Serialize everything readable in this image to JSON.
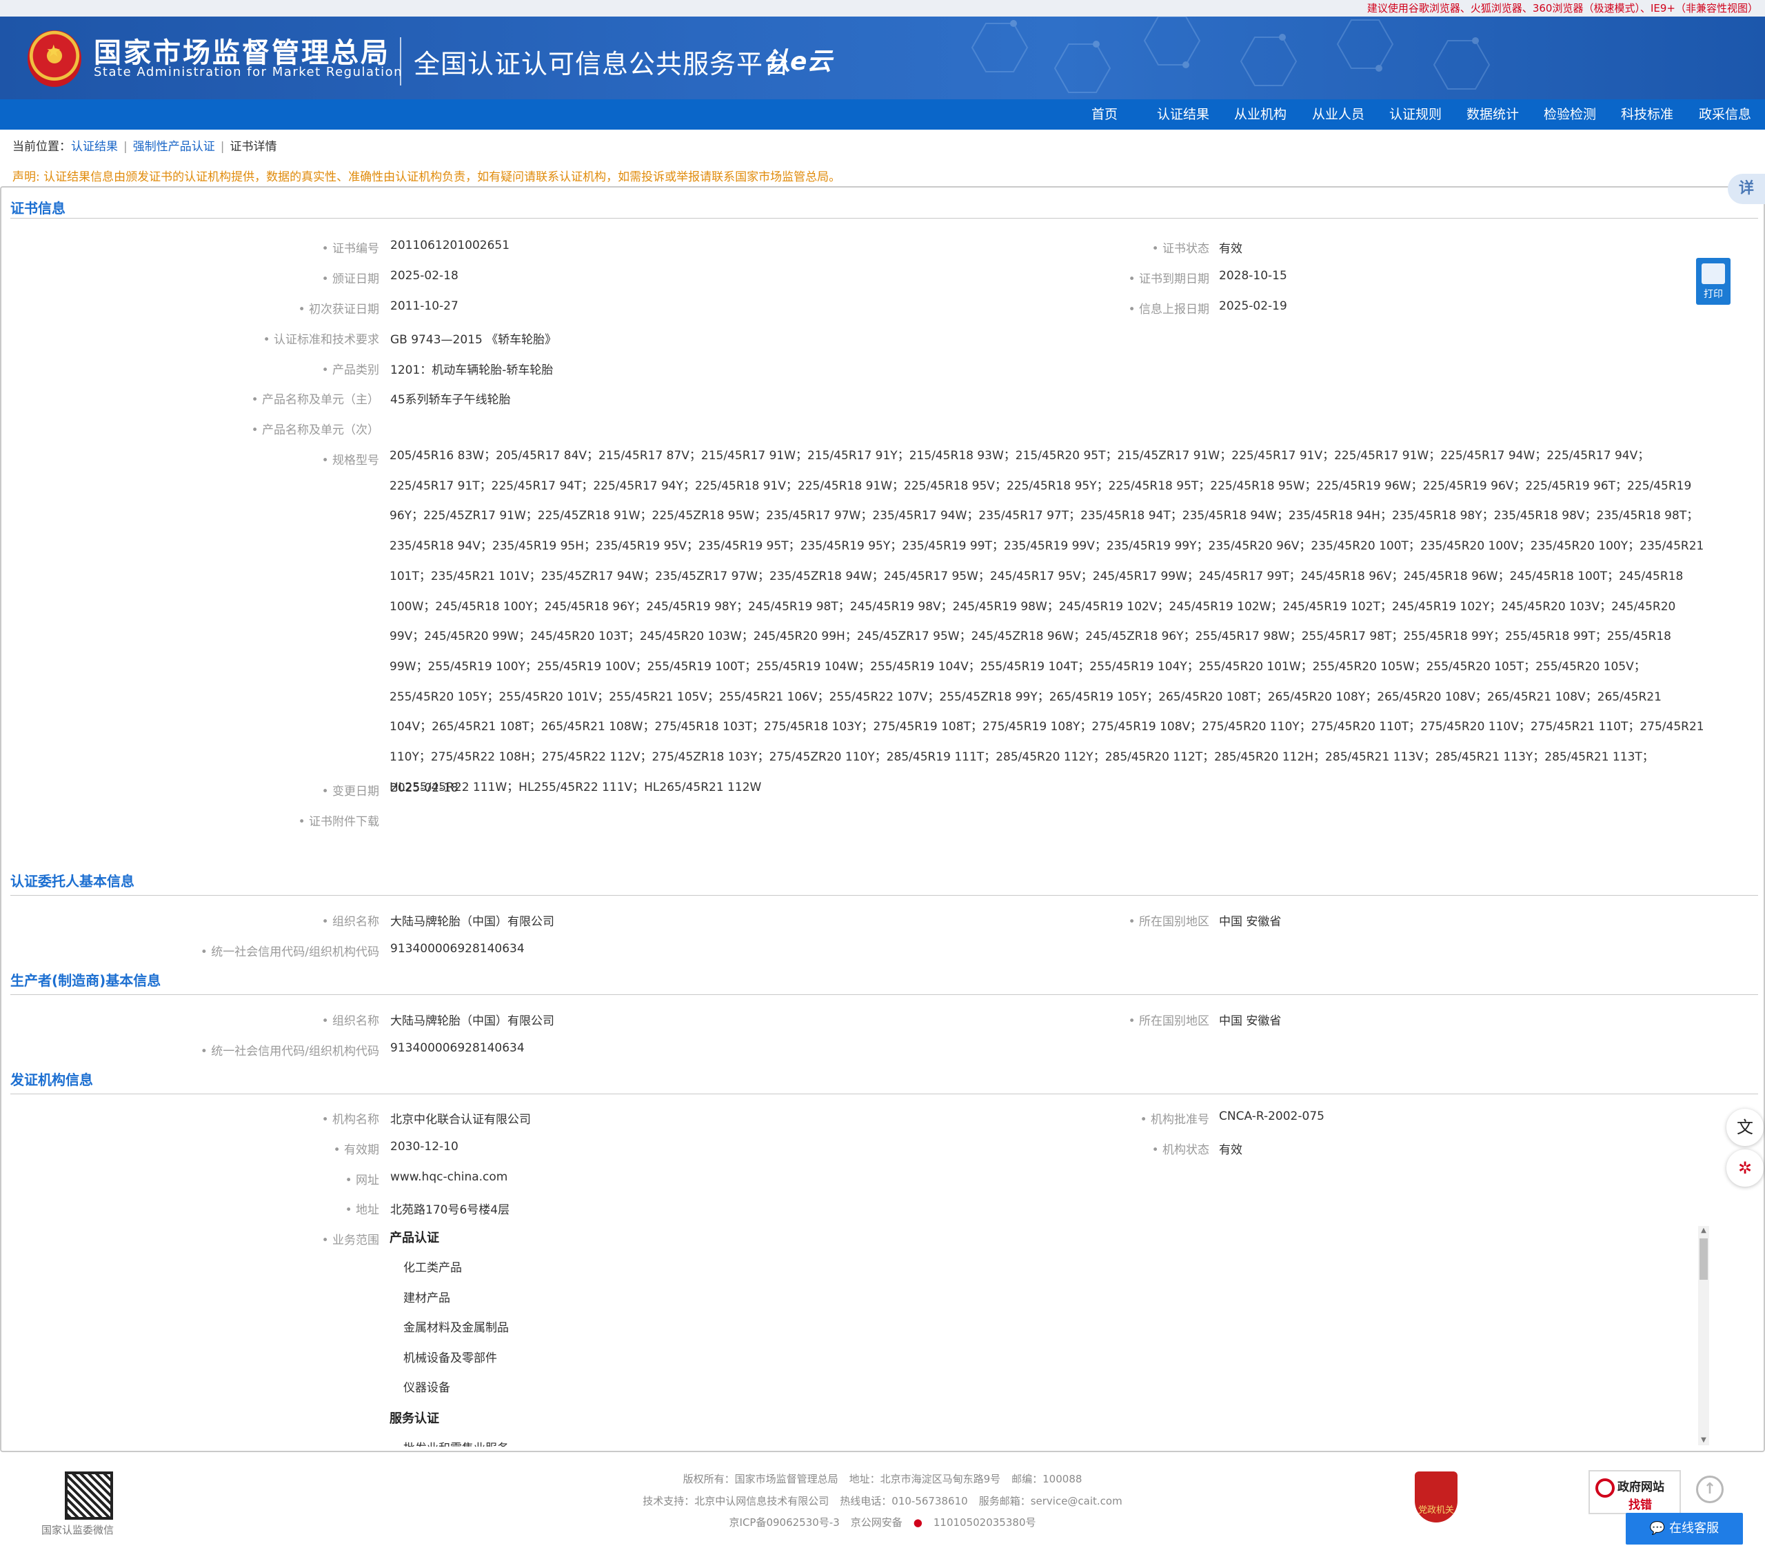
{
  "notice": "建议使用谷歌浏览器、火狐浏览器、360浏览器（极速模式）、IE9+（非兼容性视图）",
  "header": {
    "brand_cn": "国家市场监督管理总局",
    "brand_en": "State Administration  for  Market Regulation",
    "platform": "全国认证认可信息公共服务平台",
    "platform_logo": "认e云"
  },
  "nav": [
    "首页",
    "认证结果",
    "从业机构",
    "从业人员",
    "认证规则",
    "数据统计",
    "检验检测",
    "科技标准",
    "政采信息"
  ],
  "breadcrumb": {
    "prefix": "当前位置：",
    "items": [
      "认证结果",
      "强制性产品认证",
      "证书详情"
    ]
  },
  "statement": "声明: 认证结果信息由颁发证书的认证机构提供，数据的真实性、准确性由认证机构负责，如有疑问请联系认证机构，如需投诉或举报请联系国家市场监管总局。",
  "float_tab": "详",
  "print_label": "打印",
  "cert": {
    "title": "证书信息",
    "no_label": "证书编号",
    "no": "2011061201002651",
    "status_label": "证书状态",
    "status": "有效",
    "issue_label": "颁证日期",
    "issue": "2025-02-18",
    "expire_label": "证书到期日期",
    "expire": "2028-10-15",
    "first_label": "初次获证日期",
    "first": "2011-10-27",
    "report_label": "信息上报日期",
    "report": "2025-02-19",
    "standard_label": "认证标准和技术要求",
    "standard": "GB 9743—2015 《轿车轮胎》",
    "category_label": "产品类别",
    "category": "1201：机动车辆轮胎-轿车轮胎",
    "product_main_label": "产品名称及单元（主）",
    "product_main": "45系列轿车子午线轮胎",
    "product_sub_label": "产品名称及单元（次）",
    "product_sub": "",
    "models_label": "规格型号",
    "models": "205/45R16 83W；205/45R17 84V；215/45R17 87V；215/45R17 91W；215/45R17 91Y；215/45R18 93W；215/45R20 95T；215/45ZR17 91W；225/45R17 91V；225/45R17 91W；225/45R17 94W；225/45R17 94V；225/45R17 91T；225/45R17 94T；225/45R17 94Y；225/45R18 91V；225/45R18 91W；225/45R18 95V；225/45R18 95Y；225/45R18 95T；225/45R18 95W；225/45R19 96W；225/45R19 96V；225/45R19 96T；225/45R19 96Y；225/45ZR17 91W；225/45ZR18 91W；225/45ZR18 95W；235/45R17 97W；235/45R17 94W；235/45R17 97T；235/45R18 94T；235/45R18 94W；235/45R18 94H；235/45R18 98Y；235/45R18 98V；235/45R18 98T；235/45R18 94V；235/45R19 95H；235/45R19 95V；235/45R19 95T；235/45R19 95Y；235/45R19 99T；235/45R19 99V；235/45R19 99Y；235/45R20 96V；235/45R20 100T；235/45R20 100V；235/45R20 100Y；235/45R21 101T；235/45R21 101V；235/45ZR17 94W；235/45ZR17 97W；235/45ZR18 94W；245/45R17 95W；245/45R17 95V；245/45R17 99W；245/45R17 99T；245/45R18 96V；245/45R18 96W；245/45R18 100T；245/45R18 100W；245/45R18 100Y；245/45R18 96Y；245/45R19 98Y；245/45R19 98T；245/45R19 98V；245/45R19 98W；245/45R19 102V；245/45R19 102W；245/45R19 102T；245/45R19 102Y；245/45R20 103V；245/45R20 99V；245/45R20 99W；245/45R20 103T；245/45R20 103W；245/45R20 99H；245/45ZR17 95W；245/45ZR18 96W；245/45ZR18 96Y；255/45R17 98W；255/45R17 98T；255/45R18 99Y；255/45R18 99T；255/45R18 99W；255/45R19 100Y；255/45R19 100V；255/45R19 100T；255/45R19 104W；255/45R19 104V；255/45R19 104T；255/45R19 104Y；255/45R20 101W；255/45R20 105W；255/45R20 105T；255/45R20 105V；255/45R20 105Y；255/45R20 101V；255/45R21 105V；255/45R21 106V；255/45R22 107V；255/45ZR18 99Y；265/45R19 105Y；265/45R20 108T；265/45R20 108Y；265/45R20 108V；265/45R21 108V；265/45R21 104V；265/45R21 108T；265/45R21 108W；275/45R18 103T；275/45R18 103Y；275/45R19 108T；275/45R19 108Y；275/45R19 108V；275/45R20 110Y；275/45R20 110T；275/45R20 110V；275/45R21 110T；275/45R21 110Y；275/45R22 108H；275/45R22 112V；275/45ZR18 103Y；275/45ZR20 110Y；285/45R19 111T；285/45R20 112Y；285/45R20 112T；285/45R20 112H；285/45R21 113V；285/45R21 113Y；285/45R21 113T；HL255/45R22 111W；HL255/45R22 111V；HL265/45R21 112W",
    "change_label": "变更日期",
    "change": "2025-02-18",
    "attach_label": "证书附件下载"
  },
  "client": {
    "title": "认证委托人基本信息",
    "org_label": "组织名称",
    "org": "大陆马牌轮胎（中国）有限公司",
    "region_label": "所在国别地区",
    "region": "中国 安徽省",
    "code_label": "统一社会信用代码/组织机构代码",
    "code": "913400006928140634"
  },
  "maker": {
    "title": "生产者(制造商)基本信息",
    "org_label": "组织名称",
    "org": "大陆马牌轮胎（中国）有限公司",
    "region_label": "所在国别地区",
    "region": "中国 安徽省",
    "code_label": "统一社会信用代码/组织机构代码",
    "code": "913400006928140634"
  },
  "issuer": {
    "title": "发证机构信息",
    "name_label": "机构名称",
    "name": "北京中化联合认证有限公司",
    "approval_label": "机构批准号",
    "approval": "CNCA-R-2002-075",
    "valid_label": "有效期",
    "valid": "2030-12-10",
    "state_label": "机构状态",
    "state": "有效",
    "site_label": "网址",
    "site": "www.hqc-china.com",
    "addr_label": "地址",
    "addr": "北苑路170号6号楼4层",
    "scope_label": "业务范围",
    "scope_cat1": "产品认证",
    "scope_items1": [
      "化工类产品",
      "建材产品",
      "金属材料及金属制品",
      "机械设备及零部件",
      "仪器设备"
    ],
    "scope_cat2": "服务认证",
    "scope_item2_partial": "批发业和零售业服务"
  },
  "footer": {
    "qr_label": "国家认监委微信",
    "l1_a": "版权所有：国家市场监督管理总局",
    "l1_b": "地址：北京市海淀区马甸东路9号",
    "l1_c": "邮编：100088",
    "l2_a": "技术支持：北京中认网信息技术有限公司",
    "l2_b": "热线电话：010-56738610",
    "l2_c": "服务邮箱：service@cait.com",
    "l3_a": "京ICP备09062530号-3",
    "l3_b": "京公网安备",
    "l3_c": "11010502035380号",
    "badge": "党政机关",
    "gov_error_1": "政府网站",
    "gov_error_2": "找错",
    "chat": "在线客服"
  }
}
